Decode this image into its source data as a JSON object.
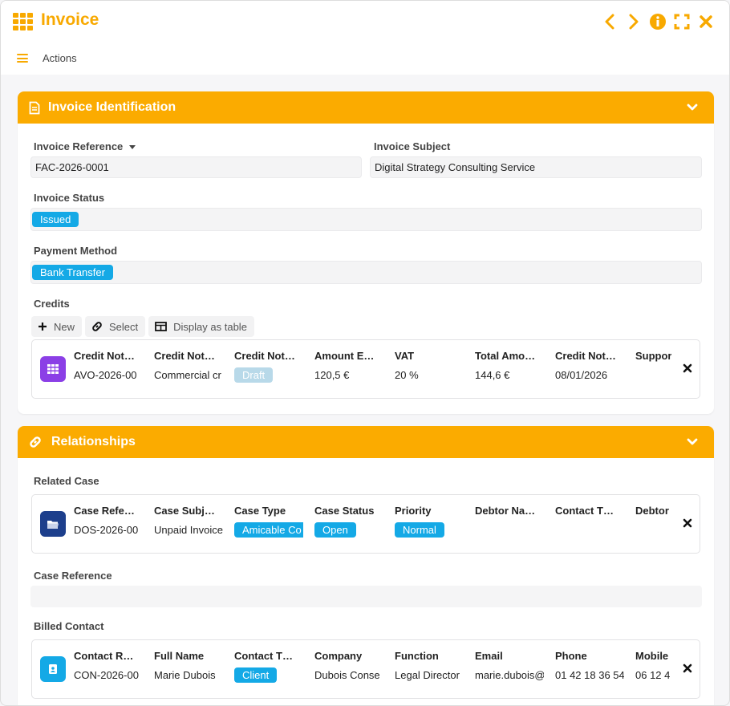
{
  "window": {
    "title": "Invoice",
    "icons": [
      "grid-icon",
      "chevron-left-icon",
      "chevron-right-icon",
      "info-icon",
      "fullscreen-icon",
      "close-icon"
    ]
  },
  "actions": {
    "label": "Actions"
  },
  "colors": {
    "accent": "#fbab00",
    "badge": "#14a9e6",
    "purple": "#8b3fe6",
    "navy": "#1d3f8c"
  },
  "identification": {
    "title": "Invoice Identification",
    "reference_label": "Invoice Reference",
    "reference_value": "FAC-2026-0001",
    "subject_label": "Invoice Subject",
    "subject_value": "Digital Strategy Consulting Service",
    "status_label": "Invoice Status",
    "status_value": "Issued",
    "payment_label": "Payment Method",
    "payment_value": "Bank Transfer",
    "credits_label": "Credits",
    "buttons": {
      "new": "New",
      "select": "Select",
      "table": "Display as table"
    },
    "credits_table": {
      "headers": [
        "Credit Not…",
        "Credit Not…",
        "Credit Not…",
        "Amount E…",
        "VAT",
        "Total Amo…",
        "Credit Not…",
        "Suppor"
      ],
      "row": [
        "AVO-2026-00",
        "Commercial cr",
        "Draft",
        "120,5 €",
        "20 %",
        "144,6 €",
        "08/01/2026",
        ""
      ]
    }
  },
  "relationships": {
    "title": "Relationships",
    "related_case_label": "Related Case",
    "case_table": {
      "headers": [
        "Case Refe…",
        "Case Subj…",
        "Case Type",
        "Case Status",
        "Priority",
        "Debtor Na…",
        "Contact T…",
        "Debtor"
      ],
      "row": [
        "DOS-2026-00",
        "Unpaid Invoice",
        "Amicable Co",
        "Open",
        "Normal",
        "",
        "",
        ""
      ]
    },
    "case_reference_label": "Case Reference",
    "case_reference_value": "",
    "billed_contact_label": "Billed Contact",
    "contact_table": {
      "headers": [
        "Contact R…",
        "Full Name",
        "Contact T…",
        "Company",
        "Function",
        "Email",
        "Phone",
        "Mobile"
      ],
      "row": [
        "CON-2026-00",
        "Marie Dubois",
        "Client",
        "Dubois Conse",
        "Legal Director",
        "marie.dubois@",
        "01 42 18 36 54",
        "06 12 4"
      ]
    }
  }
}
